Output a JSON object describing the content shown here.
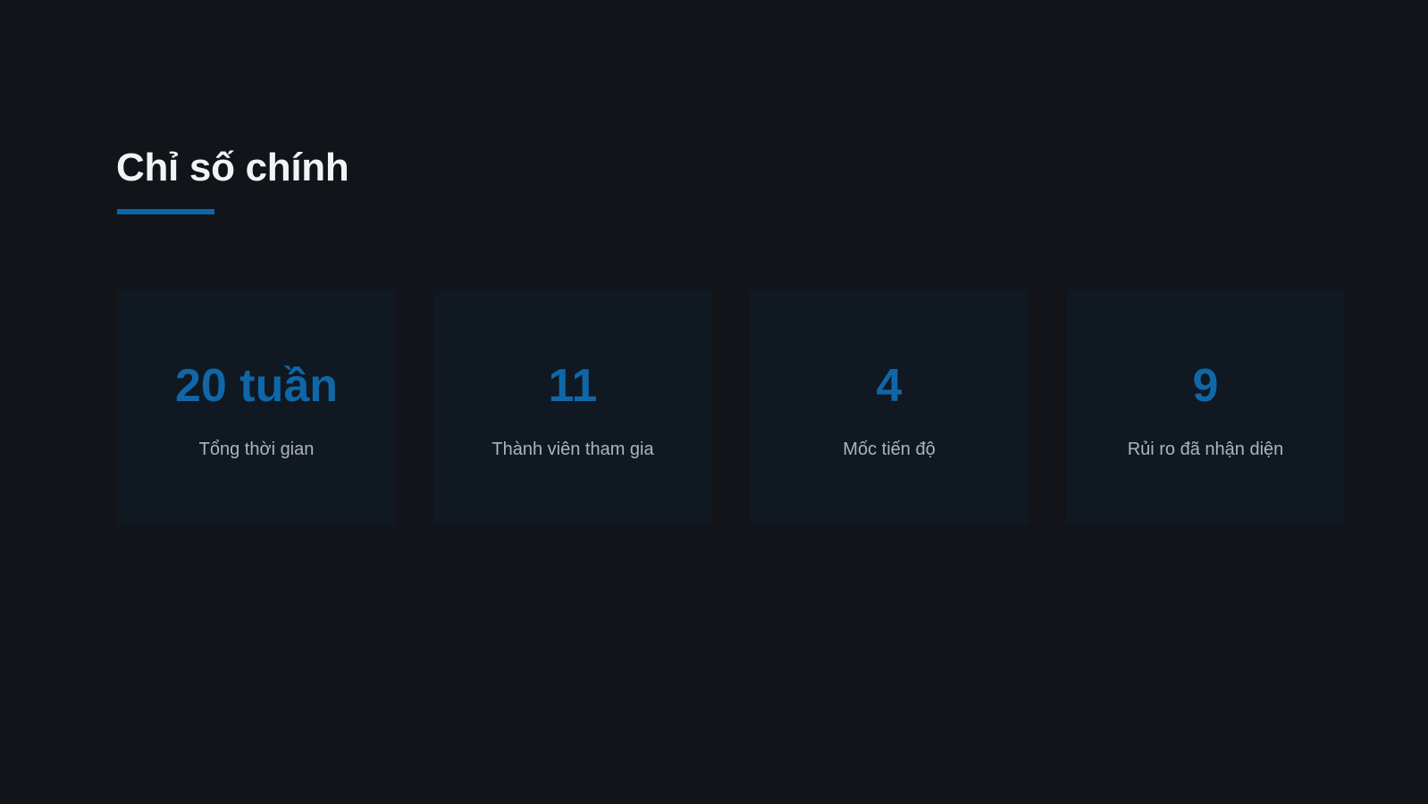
{
  "title": "Chỉ số chính",
  "colors": {
    "background": "#121419",
    "accent": "#0A66AE",
    "value": "#0F67A8",
    "card_background": "#101822",
    "title_text": "#F1F3F6",
    "label_text": "#AEB4BD"
  },
  "metrics": [
    {
      "value": "20 tuần",
      "label": "Tổng thời gian"
    },
    {
      "value": "11",
      "label": "Thành viên tham gia"
    },
    {
      "value": "4",
      "label": "Mốc tiến độ"
    },
    {
      "value": "9",
      "label": "Rủi ro đã nhận diện"
    }
  ]
}
